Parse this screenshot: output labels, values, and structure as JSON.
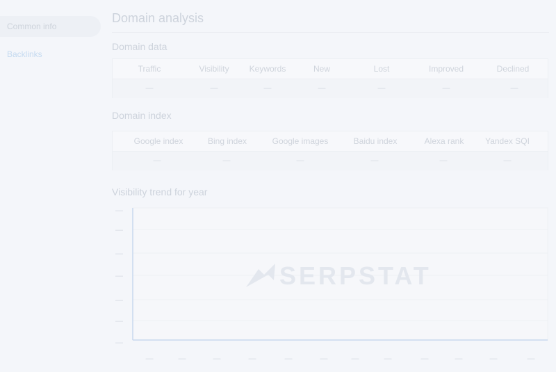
{
  "sidebar": {
    "items": [
      {
        "label": "Common info"
      },
      {
        "label": "Backlinks"
      }
    ]
  },
  "page": {
    "title": "Domain analysis"
  },
  "domain_data": {
    "title": "Domain data",
    "columns": [
      "Traffic",
      "Visibility",
      "Keywords",
      "New",
      "Lost",
      "Improved",
      "Declined"
    ],
    "values": [
      "—",
      "—",
      "—",
      "—",
      "—",
      "—",
      "—"
    ]
  },
  "domain_index": {
    "title": "Domain index",
    "columns": [
      "Google index",
      "Bing index",
      "Google images",
      "Baidu index",
      "Alexa rank",
      "Yandex SQI"
    ],
    "values": [
      "—",
      "—",
      "—",
      "—",
      "—",
      "—"
    ]
  },
  "visibility_trend": {
    "title": "Visibility trend for year",
    "y_ticks": [
      "—",
      "—",
      "—",
      "—",
      "—",
      "—",
      "—"
    ],
    "x_ticks": [
      "—",
      "—",
      "—",
      "—",
      "—",
      "—",
      "—",
      "—",
      "—",
      "—",
      "—",
      "—"
    ]
  },
  "watermark": {
    "text": "SERPSTAT",
    "icon": "serpstat-logo-icon"
  },
  "colors": {
    "background": "#f4f6fa",
    "axis": "#c8d8ee",
    "muted_text": "#cfd4dc",
    "link": "#c5daf0"
  }
}
